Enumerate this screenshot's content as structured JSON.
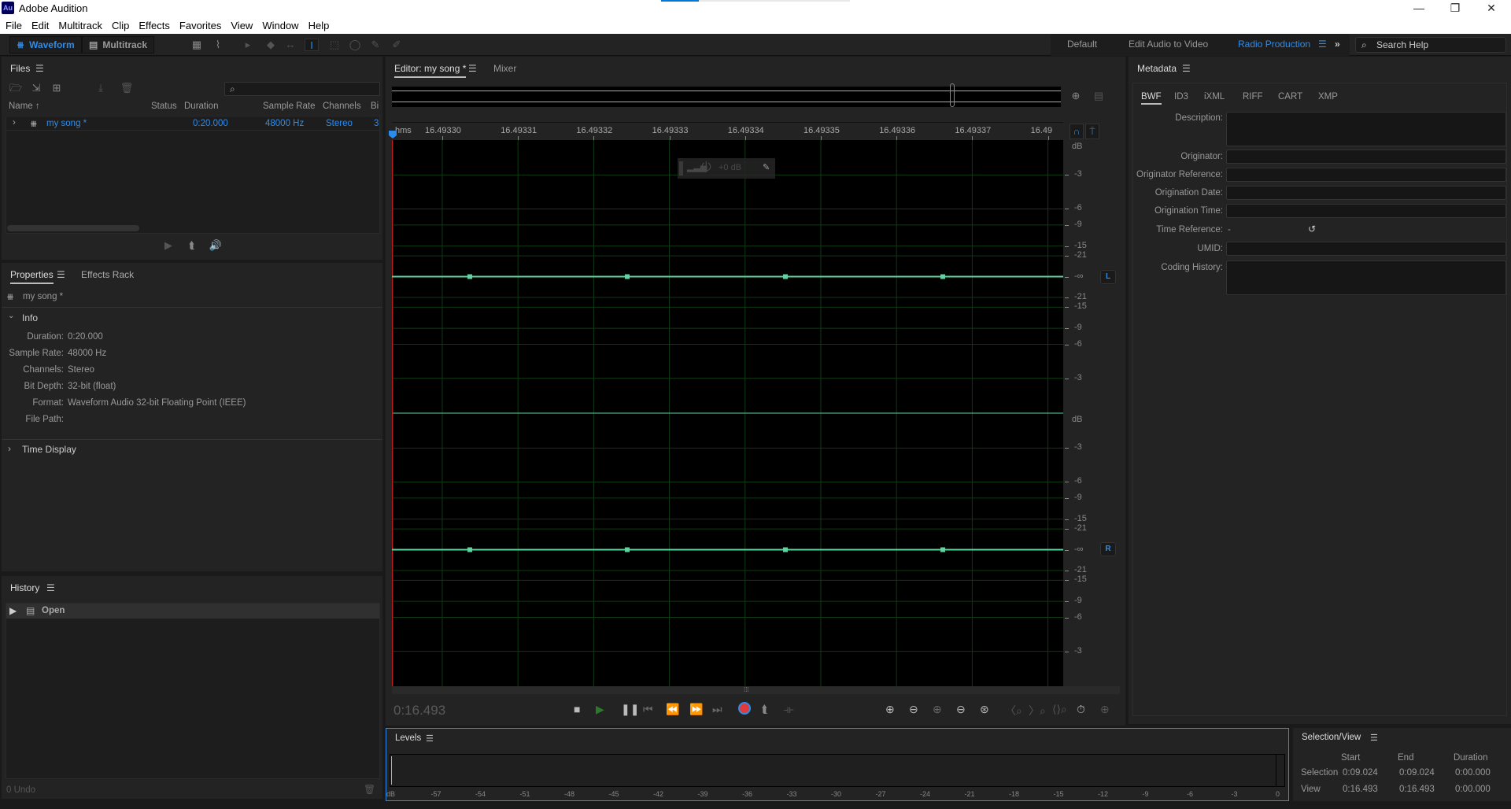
{
  "app": {
    "title": "Adobe Audition",
    "logo": "Au",
    "window_controls": {
      "minimize": "—",
      "restore": "❐",
      "close": "✕"
    }
  },
  "menu": [
    "File",
    "Edit",
    "Multitrack",
    "Clip",
    "Effects",
    "Favorites",
    "View",
    "Window",
    "Help"
  ],
  "toolbar": {
    "waveform_label": "Waveform",
    "multitrack_label": "Multitrack",
    "workspaces": [
      "Default",
      "Edit Audio to Video",
      "Radio Production"
    ],
    "active_workspace": "Radio Production",
    "more": "»",
    "search_placeholder": "Search Help"
  },
  "files": {
    "title": "Files",
    "search_placeholder": "",
    "columns": [
      "Name ↑",
      "Status",
      "Duration",
      "Sample Rate",
      "Channels",
      "Bi"
    ],
    "rows": [
      {
        "name": "my song *",
        "status": "",
        "duration": "0:20.000",
        "sample_rate": "48000 Hz",
        "channels": "Stereo",
        "bit": "3"
      }
    ]
  },
  "properties": {
    "tabs": [
      "Properties",
      "Effects Rack"
    ],
    "file": "my song *",
    "info_label": "Info",
    "info": [
      {
        "label": "Duration:",
        "value": "0:20.000"
      },
      {
        "label": "Sample Rate:",
        "value": "48000 Hz"
      },
      {
        "label": "Channels:",
        "value": "Stereo"
      },
      {
        "label": "Bit Depth:",
        "value": "32-bit (float)"
      },
      {
        "label": "Format:",
        "value": "Waveform Audio 32-bit Floating Point (IEEE)"
      },
      {
        "label": "File Path:",
        "value": ""
      }
    ],
    "time_display_label": "Time Display"
  },
  "history": {
    "title": "History",
    "items": [
      "Open"
    ],
    "undo": "0 Undo"
  },
  "editor": {
    "tabs": [
      "Editor: my song *",
      "Mixer"
    ],
    "ruler_unit": "hms",
    "ruler_ticks": [
      "16.49330",
      "16.49331",
      "16.49332",
      "16.49333",
      "16.49334",
      "16.49335",
      "16.49336",
      "16.49337",
      "16.49"
    ],
    "hud_gain": "+0 dB",
    "db_label": "dB",
    "db_scale": [
      "-3",
      "-6",
      "-9",
      "-15",
      "-21",
      "-∞",
      "-21",
      "-15",
      "-9",
      "-6",
      "-3"
    ],
    "channels": [
      "L",
      "R"
    ],
    "time": "0:16.493"
  },
  "metadata": {
    "title": "Metadata",
    "tabs": [
      "BWF",
      "ID3",
      "iXML",
      "RIFF",
      "CART",
      "XMP"
    ],
    "fields": [
      {
        "label": "Description:",
        "value": ""
      },
      {
        "label": "Originator:",
        "value": ""
      },
      {
        "label": "Originator Reference:",
        "value": ""
      },
      {
        "label": "Origination Date:",
        "value": ""
      },
      {
        "label": "Origination Time:",
        "value": ""
      },
      {
        "label": "Time Reference:",
        "value": "-"
      },
      {
        "label": "UMID:",
        "value": ""
      },
      {
        "label": "Coding History:",
        "value": ""
      }
    ]
  },
  "levels": {
    "title": "Levels",
    "scale": [
      "dB",
      "-57",
      "-54",
      "-51",
      "-48",
      "-45",
      "-42",
      "-39",
      "-36",
      "-33",
      "-30",
      "-27",
      "-24",
      "-21",
      "-18",
      "-15",
      "-12",
      "-9",
      "-6",
      "-3",
      "0"
    ]
  },
  "selection_view": {
    "title": "Selection/View",
    "headers": [
      "Start",
      "End",
      "Duration"
    ],
    "rows": [
      {
        "label": "Selection",
        "start": "0:09.024",
        "end": "0:09.024",
        "duration": "0:00.000"
      },
      {
        "label": "View",
        "start": "0:16.493",
        "end": "0:16.493",
        "duration": "0:00.000"
      }
    ]
  },
  "colors": {
    "accent": "#2d8ceb",
    "waveform": "#5fd3a0",
    "record": "#e23a3a",
    "grid": "#0f3a12"
  }
}
